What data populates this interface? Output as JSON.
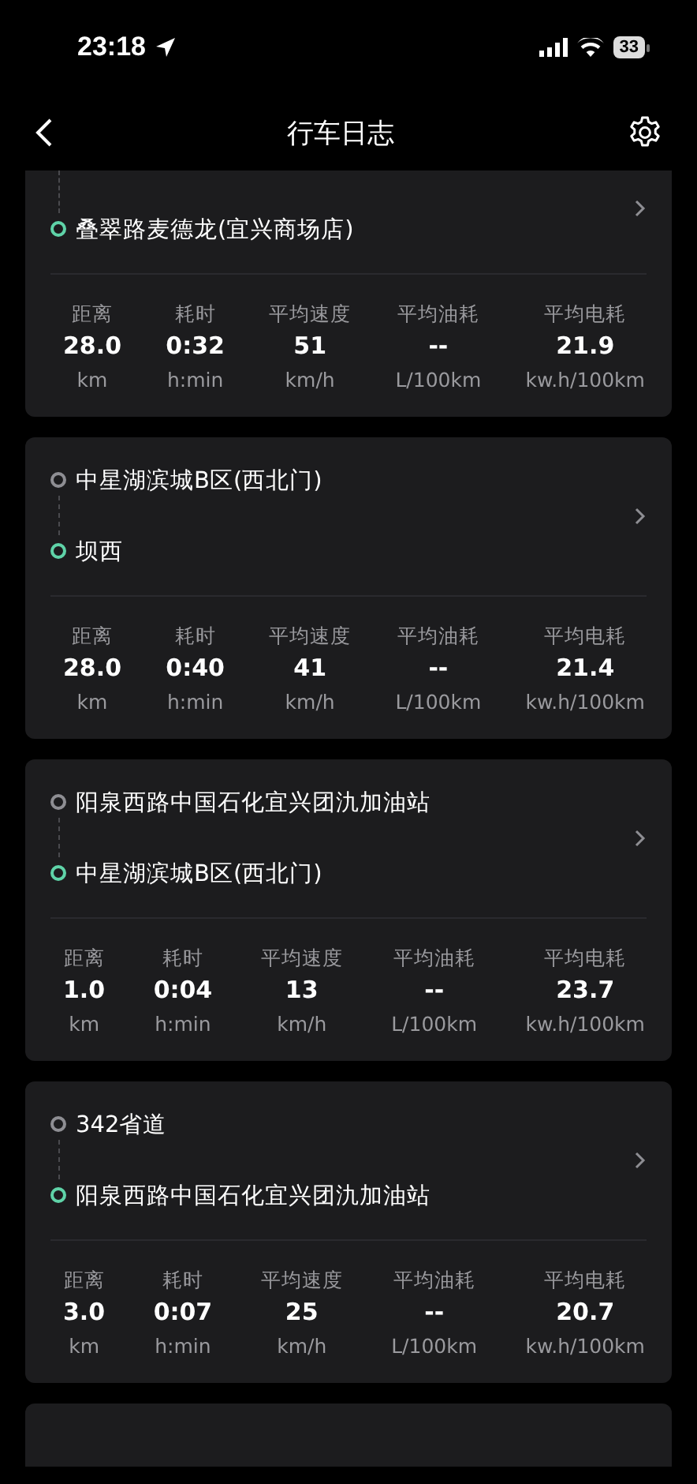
{
  "status_bar": {
    "time": "23:18",
    "battery": "33"
  },
  "nav": {
    "title": "行车日志"
  },
  "trips": [
    {
      "end": "叠翠路麦德龙(宜兴商场店)",
      "stats": [
        {
          "label": "距离",
          "value": "28.0",
          "unit": "km"
        },
        {
          "label": "耗时",
          "value": "0:32",
          "unit": "h:min"
        },
        {
          "label": "平均速度",
          "value": "51",
          "unit": "km/h"
        },
        {
          "label": "平均油耗",
          "value": "--",
          "unit": "L/100km"
        },
        {
          "label": "平均电耗",
          "value": "21.9",
          "unit": "kw.h/100km"
        }
      ]
    },
    {
      "start": "中星湖滨城B区(西北门)",
      "end": "坝西",
      "stats": [
        {
          "label": "距离",
          "value": "28.0",
          "unit": "km"
        },
        {
          "label": "耗时",
          "value": "0:40",
          "unit": "h:min"
        },
        {
          "label": "平均速度",
          "value": "41",
          "unit": "km/h"
        },
        {
          "label": "平均油耗",
          "value": "--",
          "unit": "L/100km"
        },
        {
          "label": "平均电耗",
          "value": "21.4",
          "unit": "kw.h/100km"
        }
      ]
    },
    {
      "start": "阳泉西路中国石化宜兴团氿加油站",
      "end": "中星湖滨城B区(西北门)",
      "stats": [
        {
          "label": "距离",
          "value": "1.0",
          "unit": "km"
        },
        {
          "label": "耗时",
          "value": "0:04",
          "unit": "h:min"
        },
        {
          "label": "平均速度",
          "value": "13",
          "unit": "km/h"
        },
        {
          "label": "平均油耗",
          "value": "--",
          "unit": "L/100km"
        },
        {
          "label": "平均电耗",
          "value": "23.7",
          "unit": "kw.h/100km"
        }
      ]
    },
    {
      "start": "342省道",
      "end": "阳泉西路中国石化宜兴团氿加油站",
      "stats": [
        {
          "label": "距离",
          "value": "3.0",
          "unit": "km"
        },
        {
          "label": "耗时",
          "value": "0:07",
          "unit": "h:min"
        },
        {
          "label": "平均速度",
          "value": "25",
          "unit": "km/h"
        },
        {
          "label": "平均油耗",
          "value": "--",
          "unit": "L/100km"
        },
        {
          "label": "平均电耗",
          "value": "20.7",
          "unit": "kw.h/100km"
        }
      ]
    }
  ]
}
